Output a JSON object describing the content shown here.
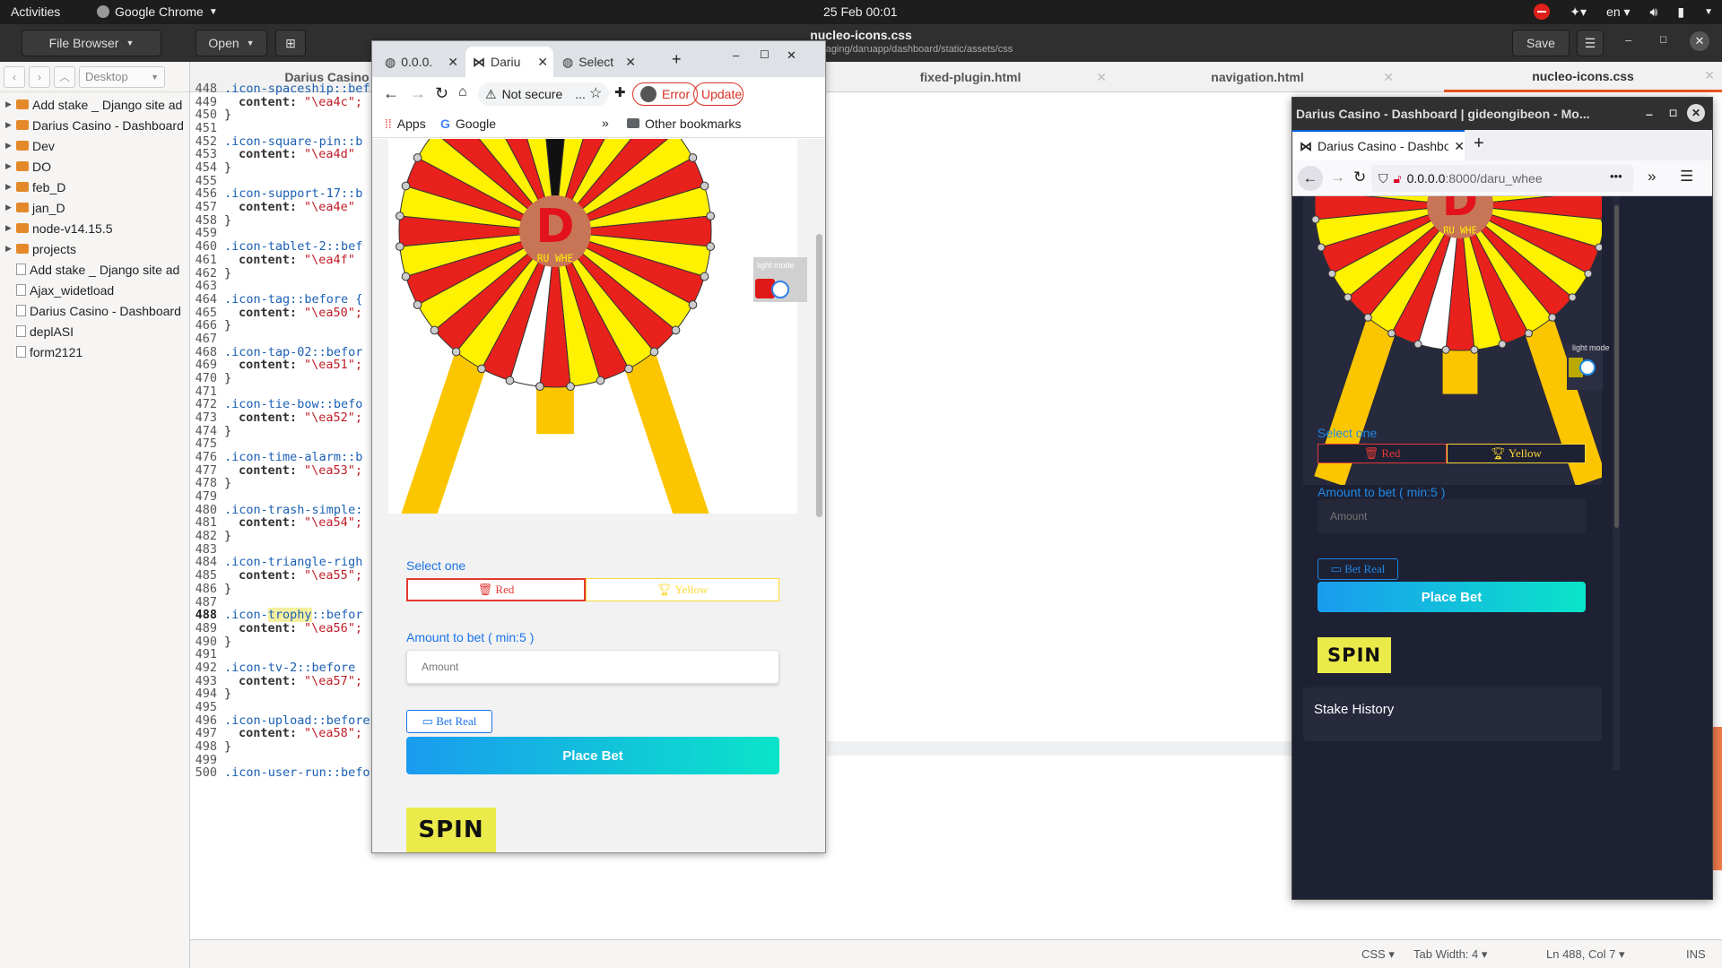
{
  "topbar": {
    "activities": "Activities",
    "app_name": "Google Chrome",
    "clock": "25 Feb  00:01",
    "lang": "en"
  },
  "gedit": {
    "file_browser_btn": "File Browser",
    "open_btn": "Open",
    "save_btn": "Save",
    "title": "nucleo-icons.css",
    "subtitle": "~/projects/darusite/daru_staging/daruapp/dashboard/static/assets/css",
    "tabs": [
      "Darius Casino",
      "fixed-plugin.html",
      "navigation.html",
      "nucleo-icons.css"
    ]
  },
  "sidebar": {
    "location": "Desktop",
    "items": [
      {
        "label": "Add stake _ Django site ad",
        "type": "folder"
      },
      {
        "label": "Darius Casino - Dashboard",
        "type": "folder"
      },
      {
        "label": "Dev",
        "type": "folder"
      },
      {
        "label": "DO",
        "type": "folder"
      },
      {
        "label": "feb_D",
        "type": "folder"
      },
      {
        "label": "jan_D",
        "type": "folder"
      },
      {
        "label": "node-v14.15.5",
        "type": "folder"
      },
      {
        "label": "projects",
        "type": "folder"
      },
      {
        "label": "Add stake _ Django site ad",
        "type": "file"
      },
      {
        "label": "Ajax_widetload",
        "type": "file"
      },
      {
        "label": "Darius Casino - Dashboard",
        "type": "file"
      },
      {
        "label": "deplASI",
        "type": "file"
      },
      {
        "label": "form2121",
        "type": "file"
      }
    ]
  },
  "code_lines": [
    {
      "n": "448",
      "sel": ".icon-spaceship::bef",
      "prop": "",
      "val": ""
    },
    {
      "n": "449",
      "sel": "",
      "prop": "content:",
      "val": "\"\\ea4c\";"
    },
    {
      "n": "450",
      "sel": "}",
      "prop": "",
      "val": ""
    },
    {
      "n": "451",
      "sel": "",
      "prop": "",
      "val": ""
    },
    {
      "n": "452",
      "sel": ".icon-square-pin::b",
      "prop": "",
      "val": ""
    },
    {
      "n": "453",
      "sel": "",
      "prop": "content:",
      "val": "\"\\ea4d\""
    },
    {
      "n": "454",
      "sel": "}",
      "prop": "",
      "val": ""
    },
    {
      "n": "455",
      "sel": "",
      "prop": "",
      "val": ""
    },
    {
      "n": "456",
      "sel": ".icon-support-17::b",
      "prop": "",
      "val": ""
    },
    {
      "n": "457",
      "sel": "",
      "prop": "content:",
      "val": "\"\\ea4e\""
    },
    {
      "n": "458",
      "sel": "}",
      "prop": "",
      "val": ""
    },
    {
      "n": "459",
      "sel": "",
      "prop": "",
      "val": ""
    },
    {
      "n": "460",
      "sel": ".icon-tablet-2::bef",
      "prop": "",
      "val": ""
    },
    {
      "n": "461",
      "sel": "",
      "prop": "content:",
      "val": "\"\\ea4f\""
    },
    {
      "n": "462",
      "sel": "}",
      "prop": "",
      "val": ""
    },
    {
      "n": "463",
      "sel": "",
      "prop": "",
      "val": ""
    },
    {
      "n": "464",
      "sel": ".icon-tag::before {",
      "prop": "",
      "val": ""
    },
    {
      "n": "465",
      "sel": "",
      "prop": "content:",
      "val": "\"\\ea50\";"
    },
    {
      "n": "466",
      "sel": "}",
      "prop": "",
      "val": ""
    },
    {
      "n": "467",
      "sel": "",
      "prop": "",
      "val": ""
    },
    {
      "n": "468",
      "sel": ".icon-tap-02::befor",
      "prop": "",
      "val": ""
    },
    {
      "n": "469",
      "sel": "",
      "prop": "content:",
      "val": "\"\\ea51\";"
    },
    {
      "n": "470",
      "sel": "}",
      "prop": "",
      "val": ""
    },
    {
      "n": "471",
      "sel": "",
      "prop": "",
      "val": ""
    },
    {
      "n": "472",
      "sel": ".icon-tie-bow::befo",
      "prop": "",
      "val": ""
    },
    {
      "n": "473",
      "sel": "",
      "prop": "content:",
      "val": "\"\\ea52\";"
    },
    {
      "n": "474",
      "sel": "}",
      "prop": "",
      "val": ""
    },
    {
      "n": "475",
      "sel": "",
      "prop": "",
      "val": ""
    },
    {
      "n": "476",
      "sel": ".icon-time-alarm::b",
      "prop": "",
      "val": ""
    },
    {
      "n": "477",
      "sel": "",
      "prop": "content:",
      "val": "\"\\ea53\";"
    },
    {
      "n": "478",
      "sel": "}",
      "prop": "",
      "val": ""
    },
    {
      "n": "479",
      "sel": "",
      "prop": "",
      "val": ""
    },
    {
      "n": "480",
      "sel": ".icon-trash-simple:",
      "prop": "",
      "val": ""
    },
    {
      "n": "481",
      "sel": "",
      "prop": "content:",
      "val": "\"\\ea54\";"
    },
    {
      "n": "482",
      "sel": "}",
      "prop": "",
      "val": ""
    },
    {
      "n": "483",
      "sel": "",
      "prop": "",
      "val": ""
    },
    {
      "n": "484",
      "sel": ".icon-triangle-righ",
      "prop": "",
      "val": ""
    },
    {
      "n": "485",
      "sel": "",
      "prop": "content:",
      "val": "\"\\ea55\";"
    },
    {
      "n": "486",
      "sel": "}",
      "prop": "",
      "val": ""
    },
    {
      "n": "487",
      "sel": "",
      "prop": "",
      "val": ""
    },
    {
      "n": "488",
      "sel": ".icon-trophy::befor",
      "prop": "",
      "val": ""
    },
    {
      "n": "489",
      "sel": "",
      "prop": "content:",
      "val": "\"\\ea56\";"
    },
    {
      "n": "490",
      "sel": "}",
      "prop": "",
      "val": ""
    },
    {
      "n": "491",
      "sel": "",
      "prop": "",
      "val": ""
    },
    {
      "n": "492",
      "sel": ".icon-tv-2::before",
      "prop": "",
      "val": ""
    },
    {
      "n": "493",
      "sel": "",
      "prop": "content:",
      "val": "\"\\ea57\";"
    },
    {
      "n": "494",
      "sel": "}",
      "prop": "",
      "val": ""
    },
    {
      "n": "495",
      "sel": "",
      "prop": "",
      "val": ""
    },
    {
      "n": "496",
      "sel": ".icon-upload::before {",
      "prop": "",
      "val": ""
    },
    {
      "n": "497",
      "sel": "",
      "prop": "content:",
      "val": "\"\\ea58\";"
    },
    {
      "n": "498",
      "sel": "}",
      "prop": "",
      "val": ""
    },
    {
      "n": "499",
      "sel": "",
      "prop": "",
      "val": ""
    },
    {
      "n": "500",
      "sel": ".icon-user-run::before {",
      "prop": "",
      "val": ""
    }
  ],
  "status": {
    "lang": "CSS",
    "tab_width": "Tab Width: 4",
    "cursor": "Ln 488, Col 7",
    "mode": "INS"
  },
  "chrome": {
    "tabs": [
      "0.0.0.",
      "Dariu",
      "Select"
    ],
    "not_secure": "Not secure",
    "url_ellipsis": "...",
    "error_label": "Error",
    "update_label": "Update",
    "apps": "Apps",
    "google": "Google",
    "other_bookmarks": "Other bookmarks"
  },
  "casino": {
    "light_mode": "light mode",
    "select_one": "Select one",
    "red_label": "Red",
    "yellow_label": "Yellow",
    "amount_label": "Amount to bet ( min:5 )",
    "amount_placeholder": "Amount",
    "bet_real": "Bet Real",
    "place_bet": "Place Bet",
    "spin": "SPIN",
    "stake_history": "Stake History",
    "logo_letter": "D",
    "hub_text": "RU WHE"
  },
  "firefox": {
    "title": "Darius Casino - Dashboard | gideongibeon - Mo...",
    "tab_title": "Darius Casino - Dashboar",
    "url_host": "0.0.0.0",
    "url_rest": ":8000/daru_whee",
    "url_dots": "•••"
  },
  "colors": {
    "red": "#e8211d",
    "yellow": "#fff200",
    "white": "#ffffff",
    "gold": "#fbc600",
    "hub": "#c87457"
  }
}
